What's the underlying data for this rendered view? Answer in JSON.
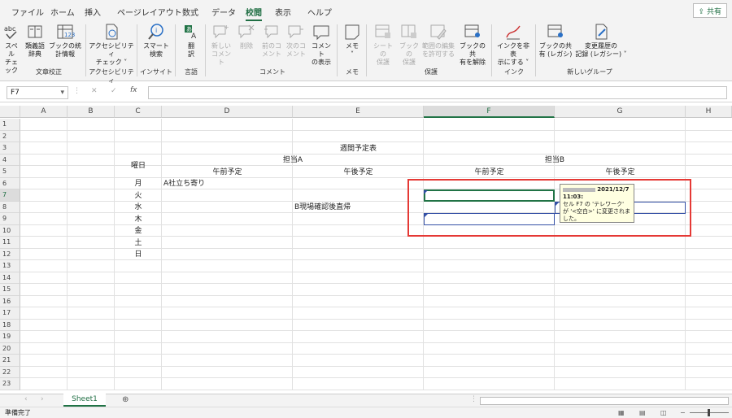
{
  "menu": {
    "tabs": [
      "ファイル",
      "ホーム",
      "挿入",
      "ページレイアウト",
      "数式",
      "データ",
      "校閲",
      "表示",
      "ヘルプ"
    ],
    "share": "共有"
  },
  "ribbon": {
    "buttons": [
      {
        "label1": "スペル",
        "label2": "チェック",
        "icon": "spellcheck-icon",
        "enabled": true
      },
      {
        "label1": "類義語",
        "label2": "辞典",
        "icon": "thesaurus-icon",
        "enabled": true
      },
      {
        "label1": "ブックの統",
        "label2": "計情報",
        "icon": "workbook-stats-icon",
        "enabled": true
      },
      {
        "label1": "アクセシビリティ",
        "label2": "チェック ˅",
        "icon": "accessibility-icon",
        "enabled": true
      },
      {
        "label1": "スマート",
        "label2": "検索",
        "icon": "smart-lookup-icon",
        "enabled": true
      },
      {
        "label1": "翻",
        "label2": "訳",
        "icon": "translate-icon",
        "enabled": true
      },
      {
        "label1": "新しい",
        "label2": "コメント",
        "icon": "new-comment-icon",
        "enabled": false
      },
      {
        "label1": "削除",
        "label2": "",
        "icon": "delete-comment-icon",
        "enabled": false
      },
      {
        "label1": "前のコ",
        "label2": "メント",
        "icon": "previous-comment-icon",
        "enabled": false
      },
      {
        "label1": "次のコ",
        "label2": "メント",
        "icon": "next-comment-icon",
        "enabled": false
      },
      {
        "label1": "コメント",
        "label2": "の表示",
        "icon": "show-comments-icon",
        "enabled": true
      },
      {
        "label1": "メモ",
        "label2": "˅",
        "icon": "notes-icon",
        "enabled": true
      },
      {
        "label1": "シートの",
        "label2": "保護",
        "icon": "protect-sheet-icon",
        "enabled": false
      },
      {
        "label1": "ブックの",
        "label2": "保護",
        "icon": "protect-workbook-icon",
        "enabled": false
      },
      {
        "label1": "範囲の編集",
        "label2": "を許可する",
        "icon": "allow-edit-ranges-icon",
        "enabled": false
      },
      {
        "label1": "ブックの共",
        "label2": "有を解除",
        "icon": "unshare-workbook-icon",
        "enabled": true
      },
      {
        "label1": "インクを非表",
        "label2": "示にする ˅",
        "icon": "hide-ink-icon",
        "enabled": true
      },
      {
        "label1": "ブックの共",
        "label2": "有 (レガシ)",
        "icon": "share-legacy-icon",
        "enabled": true
      },
      {
        "label1": "変更履歴の",
        "label2": "記録 (レガシー) ˅",
        "icon": "track-changes-icon",
        "enabled": true
      }
    ],
    "groups": [
      "文章校正",
      "アクセシビリティ",
      "インサイト",
      "言語",
      "コメント",
      "メモ",
      "保護",
      "インク",
      "新しいグループ"
    ]
  },
  "formula_bar": {
    "name_box": "F7",
    "fx": "fx",
    "value": ""
  },
  "columns": [
    "A",
    "B",
    "C",
    "D",
    "E",
    "F",
    "G",
    "H"
  ],
  "selected_column": "F",
  "rows": [
    "1",
    "2",
    "3",
    "4",
    "5",
    "6",
    "7",
    "8",
    "9",
    "10",
    "11",
    "12",
    "13",
    "14",
    "15",
    "16",
    "17",
    "18",
    "19",
    "20",
    "21",
    "22",
    "23"
  ],
  "selected_row": "7",
  "cells": {
    "title": "週間予定表",
    "weekday_header": "曜日",
    "owner_a": "担当A",
    "owner_b": "担当B",
    "am_a": "午前予定",
    "pm_a": "午後予定",
    "am_b": "午前予定",
    "pm_b": "午後予定",
    "days": [
      "月",
      "火",
      "水",
      "木",
      "金",
      "土",
      "日"
    ],
    "d6": "A社立ち寄り",
    "e8": "B現場確認後直帰"
  },
  "tooltip": {
    "date": "2021/12/7",
    "time": "11:03:",
    "text1": "セル F7 の 'テレワーク'",
    "text2": "が '<空白>' に変更されま",
    "text3": "した。"
  },
  "sheet": {
    "tab": "Sheet1",
    "add": "⊕"
  },
  "status": {
    "text": "準備完了"
  },
  "colors": {
    "accent": "#217346",
    "highlight_box": "#e53935",
    "tooltip_bg": "#ffffe1"
  }
}
